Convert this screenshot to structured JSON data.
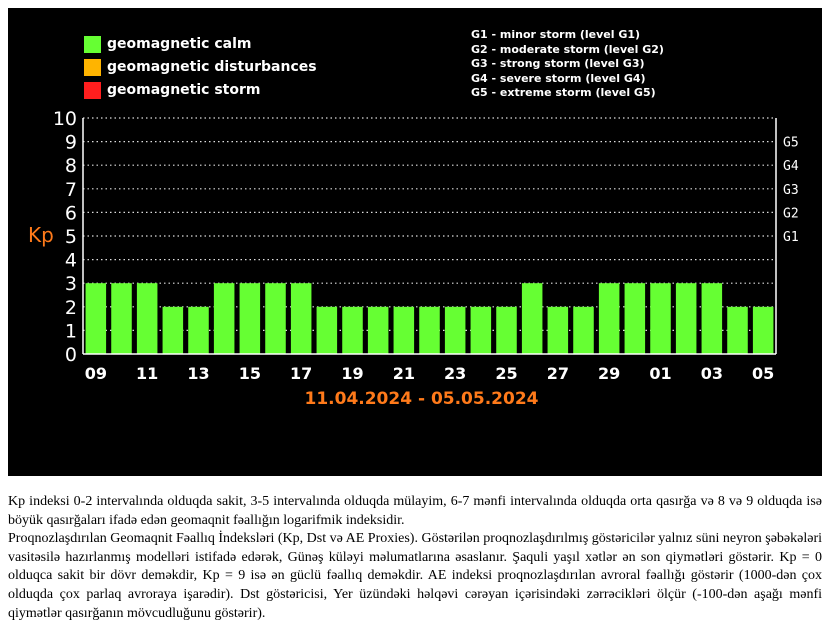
{
  "legend": [
    {
      "label": "geomagnetic calm",
      "color": "#66ff33"
    },
    {
      "label": "geomagnetic disturbances",
      "color": "#ffb400"
    },
    {
      "label": "geomagnetic storm",
      "color": "#ff1e1e"
    }
  ],
  "storm_levels": [
    "G1 - minor storm (level G1)",
    "G2 - moderate storm (level G2)",
    "G3 - strong storm (level G3)",
    "G4 - severe storm (level G4)",
    "G5 - extreme storm (level G5)"
  ],
  "chart_data": {
    "type": "bar",
    "ylabel": "Kp",
    "ylim": [
      0,
      10
    ],
    "yticks": [
      0,
      1,
      2,
      3,
      4,
      5,
      6,
      7,
      8,
      9,
      10
    ],
    "right_axis": [
      {
        "label": "G1",
        "value": 5
      },
      {
        "label": "G2",
        "value": 6
      },
      {
        "label": "G3",
        "value": 7
      },
      {
        "label": "G4",
        "value": 8
      },
      {
        "label": "G5",
        "value": 9
      }
    ],
    "xtick_labels": [
      "09",
      "11",
      "13",
      "15",
      "17",
      "19",
      "21",
      "23",
      "25",
      "27",
      "29",
      "01",
      "03",
      "05"
    ],
    "date_range": "11.04.2024 - 05.05.2024",
    "values": [
      3,
      3,
      3,
      2,
      2,
      3,
      3,
      3,
      3,
      2,
      2,
      2,
      2,
      2,
      2,
      2,
      2,
      3,
      2,
      2,
      3,
      3,
      3,
      3,
      3,
      2,
      2
    ],
    "bar_color": "#66ff33",
    "grid": "dotted horizontal",
    "colors": {
      "background": "#000000",
      "axis": "#ffffff",
      "accent": "#ff7a1a"
    }
  },
  "description": {
    "p1": "Kp indeksi 0-2 intervalında olduqda sakit, 3-5 intervalında olduqda mülayim, 6-7 mənfi intervalında olduqda orta qasırğa və 8 və 9 olduqda isə böyük qasırğaları ifadə edən geomaqnit fəallığın logarifmik indeksidir.",
    "p2": "Proqnozlaşdırılan Geomaqnit Fəallıq İndeksləri (Kp, Dst və AE Proxies). Göstərilən proqnozlaşdırılmış göstəricilər yalnız süni neyron şəbəkələri vasitəsilə hazırlanmış modelləri istifadə edərək, Günəş küləyi məlumatlarına əsaslanır. Şaquli yaşıl xətlər ən son qiymətləri göstərir. Kp = 0 olduqca sakit bir dövr deməkdir, Kp = 9 isə ən güclü fəallıq deməkdir. AE indeksi proqnozlaşdırılan avroral fəallığı göstərir (1000-dən çox olduqda çox parlaq avroraya işarədir). Dst göstəricisi, Yer üzündəki həlqəvi cərəyan içərisindəki zərrəcikləri ölçür (-100-dən aşağı mənfi qiymətlər qasırğanın mövcudluğunu göstərir)."
  }
}
